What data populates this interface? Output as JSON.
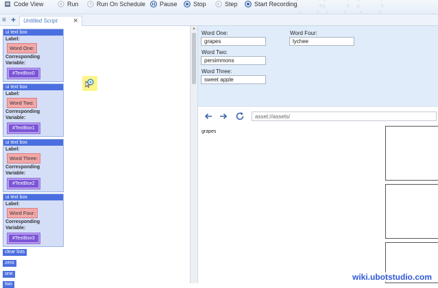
{
  "toolbar": {
    "items": [
      {
        "label": "Code View",
        "icon": "code-view-icon"
      },
      {
        "label": "Run",
        "icon": "run-icon"
      },
      {
        "label": "Run On Schedule",
        "icon": "schedule-icon"
      },
      {
        "label": "Pause",
        "icon": "pause-icon"
      },
      {
        "label": "Stop",
        "icon": "stop-icon"
      },
      {
        "label": "Step",
        "icon": "step-icon"
      },
      {
        "label": "Start Recording",
        "icon": "record-icon"
      }
    ]
  },
  "tabs": {
    "menu_glyph": "≡",
    "add_glyph": "+",
    "active_tab": "Untitled Script",
    "close_glyph": "✕"
  },
  "script": {
    "blocks": [
      {
        "title": "ui text box",
        "label_caption": "Label:",
        "label_value": "Word One:",
        "var_caption": "Corresponding Variable:",
        "var_value": "#TextBox0"
      },
      {
        "title": "ui text box",
        "label_caption": "Label:",
        "label_value": "Word Two:",
        "var_caption": "Corresponding Variable:",
        "var_value": "#TextBox1"
      },
      {
        "title": "ui text box",
        "label_caption": "Label:",
        "label_value": "Word Three:",
        "var_caption": "Corresponding Variable:",
        "var_value": "#TextBox2"
      },
      {
        "title": "ui text box",
        "label_caption": "Label:",
        "label_value": "Word Four:",
        "var_caption": "Corresponding Variable:",
        "var_value": "#TextBox3"
      }
    ],
    "commands": [
      "clear lists",
      "zero",
      "one",
      "two"
    ]
  },
  "ui_panel": {
    "fields": [
      {
        "label": "Word One:",
        "value": "grapes"
      },
      {
        "label": "Word Two:",
        "value": "persimmons"
      },
      {
        "label": "Word Three:",
        "value": "sweet apple"
      },
      {
        "label": "Word Four:",
        "value": "lychee"
      }
    ]
  },
  "browser": {
    "address": "asset://assets/",
    "page_text": "grapes"
  },
  "watermark": "wiki.ubotstudio.com",
  "colors": {
    "block_header": "#4b6fe0",
    "block_body": "#d4def7",
    "label_chip": "#f3a8a8",
    "variable_chip": "#7a56d6",
    "ui_panel_bg": "#e0ecfa",
    "accent": "#3a64a8"
  }
}
